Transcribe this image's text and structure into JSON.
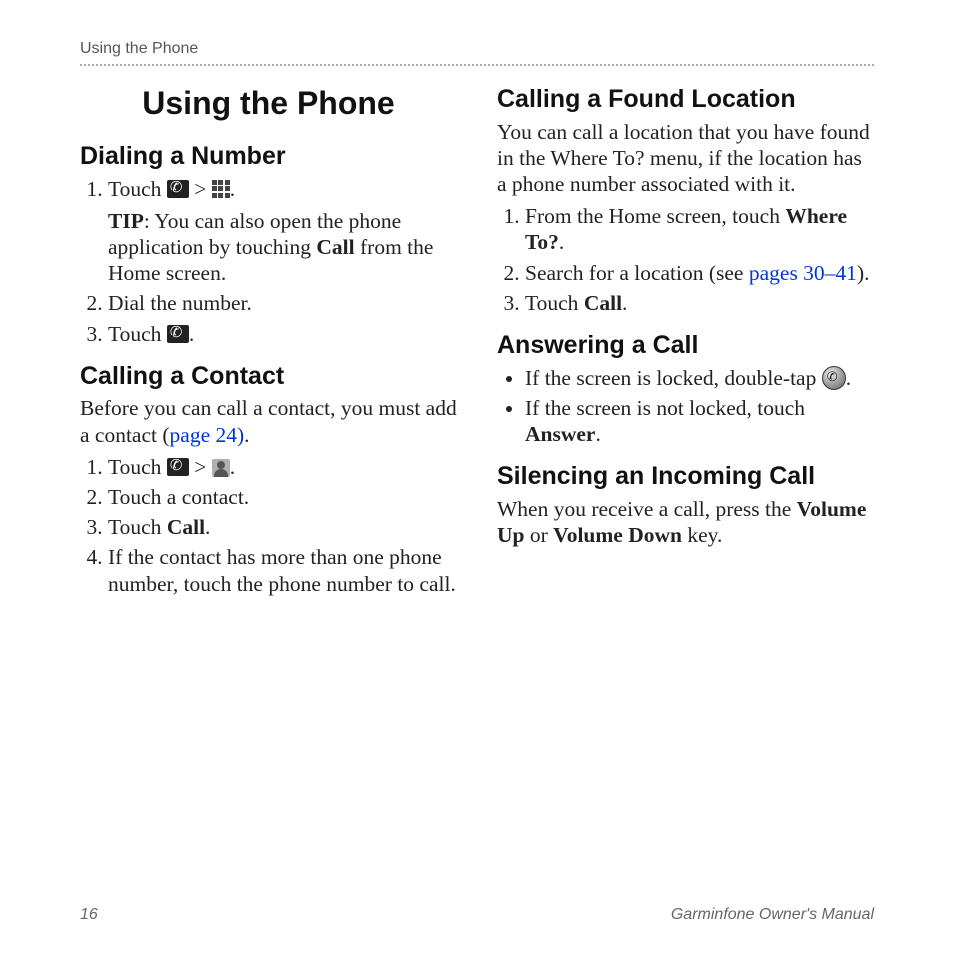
{
  "running_head": "Using the Phone",
  "page_title": "Using the Phone",
  "left": {
    "dialing_heading": "Dialing a Number",
    "dialing_step1_prefix": "Touch ",
    "dialing_step1_sep": " > ",
    "dialing_step1_suffix": ".",
    "dialing_tip_label": "TIP",
    "dialing_tip_text": ": You can also open the phone application by touching ",
    "dialing_tip_bold": "Call",
    "dialing_tip_tail": " from the Home screen.",
    "dialing_step2": "Dial the number.",
    "dialing_step3_prefix": "Touch ",
    "dialing_step3_suffix": ".",
    "contact_heading": "Calling a Contact",
    "contact_intro_a": "Before you can call a contact, you must add a contact (",
    "contact_intro_link": "page 24)",
    "contact_intro_b": ".",
    "contact_step1_prefix": "Touch ",
    "contact_step1_sep": " > ",
    "contact_step1_suffix": ".",
    "contact_step2": "Touch a contact.",
    "contact_step3_a": "Touch ",
    "contact_step3_b": "Call",
    "contact_step3_c": ".",
    "contact_step4": "If the contact has more than one phone number, touch the phone number to call."
  },
  "right": {
    "found_heading": "Calling a Found Location",
    "found_intro": "You can call a location that you have found in the Where To? menu, if the location has a phone number associated with it.",
    "found_step1_a": "From the Home screen, touch ",
    "found_step1_b": "Where To?",
    "found_step1_c": ".",
    "found_step2_a": "Search for a location (see ",
    "found_step2_link": "pages 30–41",
    "found_step2_b": ").",
    "found_step3_a": "Touch ",
    "found_step3_b": "Call",
    "found_step3_c": ".",
    "answer_heading": "Answering a Call",
    "answer_b1_a": "If the screen is locked, double-tap ",
    "answer_b1_b": ".",
    "answer_b2_a": "If the screen is not locked, touch ",
    "answer_b2_b": "Answer",
    "answer_b2_c": ".",
    "silence_heading": "Silencing an Incoming Call",
    "silence_body_a": "When you receive a call, press the ",
    "silence_body_b": "Volume Up",
    "silence_body_c": " or ",
    "silence_body_d": "Volume Down",
    "silence_body_e": " key."
  },
  "footer": {
    "page_number": "16",
    "manual_title": "Garminfone Owner's Manual"
  }
}
